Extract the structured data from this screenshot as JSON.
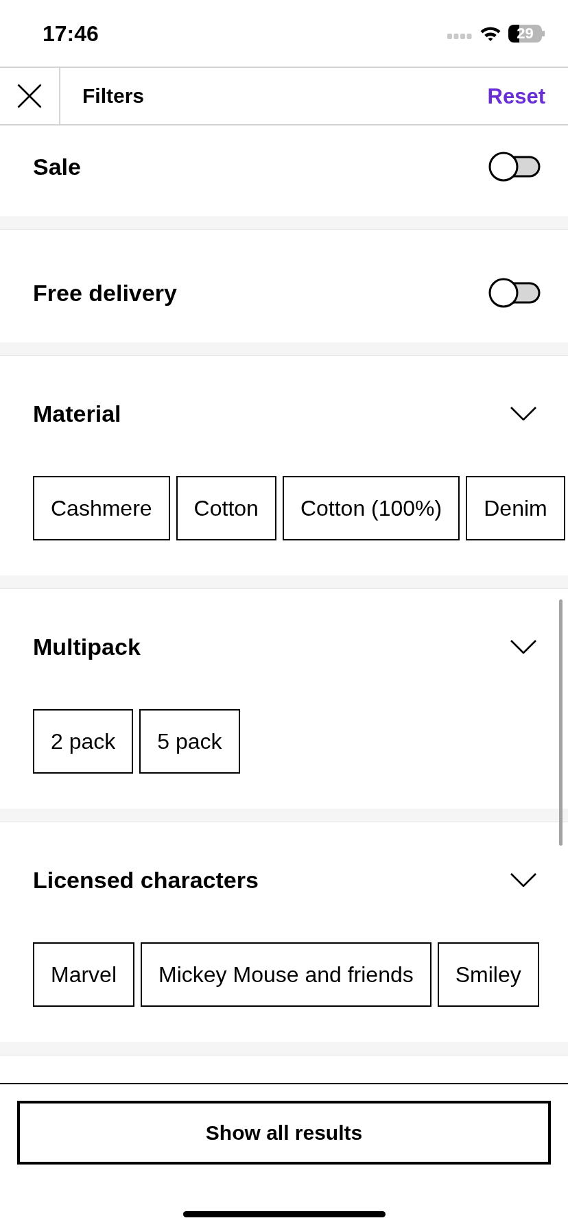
{
  "status_bar": {
    "time": "17:46",
    "battery": "29"
  },
  "header": {
    "title": "Filters",
    "reset": "Reset"
  },
  "sections": [
    {
      "kind": "toggle",
      "title": "Sale",
      "on": false
    },
    {
      "kind": "toggle",
      "title": "Free delivery",
      "on": false
    },
    {
      "kind": "chips",
      "title": "Material",
      "options": [
        {
          "label": "Cashmere",
          "selected": false
        },
        {
          "label": "Cotton",
          "selected": false
        },
        {
          "label": "Cotton (100%)",
          "selected": false
        },
        {
          "label": "Denim",
          "selected": false
        }
      ]
    },
    {
      "kind": "chips",
      "title": "Multipack",
      "options": [
        {
          "label": "2 pack",
          "selected": false
        },
        {
          "label": "5 pack",
          "selected": false
        }
      ]
    },
    {
      "kind": "chips",
      "title": "Licensed characters",
      "options": [
        {
          "label": "Marvel",
          "selected": false
        },
        {
          "label": "Mickey Mouse and friends",
          "selected": false
        },
        {
          "label": "Smiley",
          "selected": false
        }
      ]
    }
  ],
  "footer": {
    "button": "Show all results"
  }
}
